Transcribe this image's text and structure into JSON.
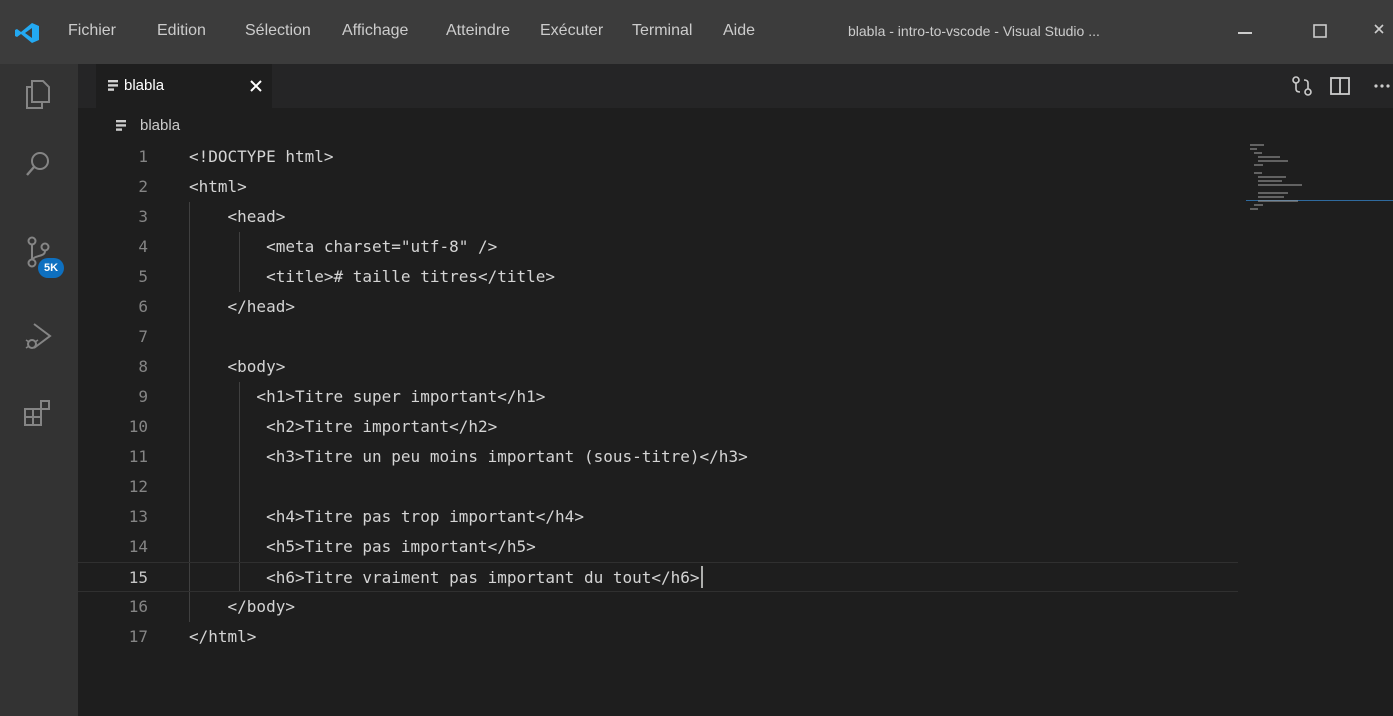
{
  "titlebar": {
    "menu": [
      "Fichier",
      "Edition",
      "Sélection",
      "Affichage",
      "Atteindre",
      "Exécuter",
      "Terminal",
      "Aide"
    ],
    "window_title": "blabla - intro-to-vscode - Visual Studio ..."
  },
  "activity_bar": {
    "items": [
      "explorer-icon",
      "search-icon",
      "source-control-icon",
      "run-debug-icon",
      "extensions-icon"
    ],
    "scm_badge": "5K"
  },
  "tab": {
    "label": "blabla",
    "icon": "file-icon"
  },
  "breadcrumb": {
    "label": "blabla"
  },
  "editor": {
    "current_line": 15,
    "lines": [
      {
        "num": "1",
        "text": "<!DOCTYPE html>"
      },
      {
        "num": "2",
        "text": "<html>"
      },
      {
        "num": "3",
        "text": "    <head>"
      },
      {
        "num": "4",
        "text": "        <meta charset=\"utf-8\" />"
      },
      {
        "num": "5",
        "text": "        <title># taille titres</title>"
      },
      {
        "num": "6",
        "text": "    </head>"
      },
      {
        "num": "7",
        "text": ""
      },
      {
        "num": "8",
        "text": "    <body>"
      },
      {
        "num": "9",
        "text": "       <h1>Titre super important</h1>"
      },
      {
        "num": "10",
        "text": "        <h2>Titre important</h2>"
      },
      {
        "num": "11",
        "text": "        <h3>Titre un peu moins important (sous-titre)</h3>"
      },
      {
        "num": "12",
        "text": ""
      },
      {
        "num": "13",
        "text": "        <h4>Titre pas trop important</h4>"
      },
      {
        "num": "14",
        "text": "        <h5>Titre pas important</h5>"
      },
      {
        "num": "15",
        "text": "        <h6>Titre vraiment pas important du tout</h6>"
      },
      {
        "num": "16",
        "text": "    </body>"
      },
      {
        "num": "17",
        "text": "</html>"
      }
    ]
  },
  "colors": {
    "titlebar": "#3c3c3c",
    "activity_bar": "#333333",
    "tab_bar": "#252526",
    "editor": "#1e1e1e",
    "badge": "#0e70c0",
    "logo": "#23a9f2"
  }
}
